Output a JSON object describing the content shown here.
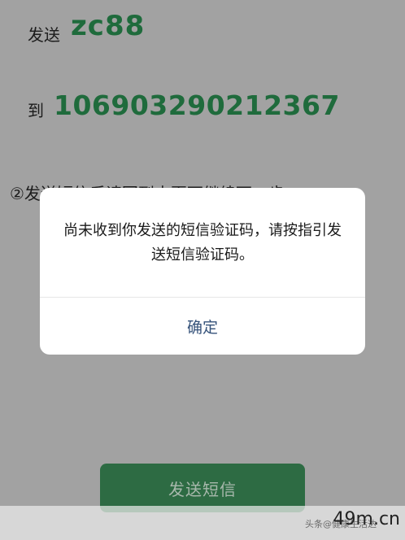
{
  "sms": {
    "send_label": "发送",
    "send_value": "zc88",
    "to_label": "到",
    "to_value": "106903290212367"
  },
  "step2_text": "②发送短信后请回到本页面继续下一步",
  "dialog": {
    "message": "尚未收到你发送的短信验证码，请按指引发送短信验证码。",
    "confirm_label": "确定"
  },
  "send_button_label": "发送短信",
  "watermark": {
    "source": "头条@健康生活达人",
    "site": "49m.cn"
  }
}
